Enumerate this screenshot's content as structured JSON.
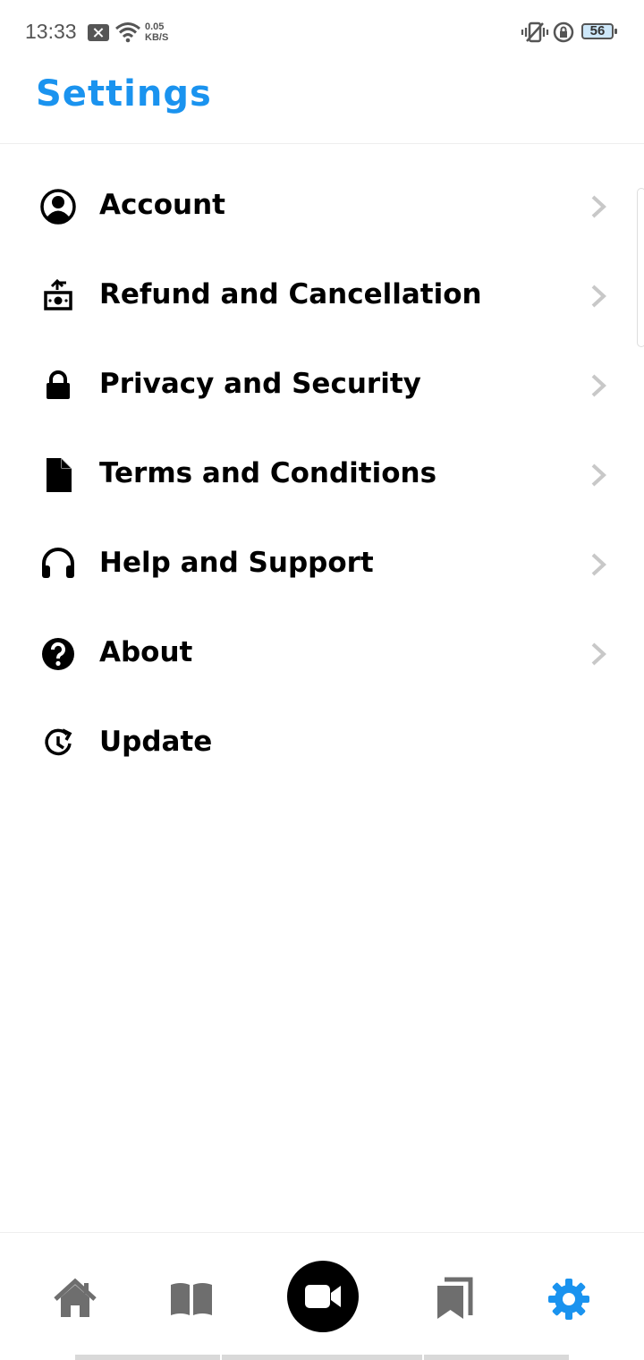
{
  "status_bar": {
    "time": "13:33",
    "speed_value": "0.05",
    "speed_unit": "KB/S",
    "battery": "56"
  },
  "header": {
    "title": "Settings"
  },
  "settings": [
    {
      "label": "Account",
      "icon": "account-circle-icon",
      "has_chevron": true
    },
    {
      "label": "Refund and Cancellation",
      "icon": "refund-icon",
      "has_chevron": true
    },
    {
      "label": "Privacy and Security",
      "icon": "lock-icon",
      "has_chevron": true
    },
    {
      "label": "Terms and Conditions",
      "icon": "document-icon",
      "has_chevron": true
    },
    {
      "label": "Help and Support",
      "icon": "headphones-icon",
      "has_chevron": true
    },
    {
      "label": "About",
      "icon": "help-circle-icon",
      "has_chevron": true
    },
    {
      "label": "Update",
      "icon": "update-icon",
      "has_chevron": false
    }
  ],
  "bottom_nav": [
    {
      "name": "home",
      "icon": "home-icon",
      "active": false
    },
    {
      "name": "library",
      "icon": "book-icon",
      "active": false
    },
    {
      "name": "record",
      "icon": "video-camera-icon",
      "active": false
    },
    {
      "name": "bookmarks",
      "icon": "bookmarks-icon",
      "active": false
    },
    {
      "name": "settings",
      "icon": "gear-icon",
      "active": true
    }
  ],
  "colors": {
    "accent": "#1a93ef",
    "inactive_icon": "#6e6e6e",
    "chevron": "#c8c8c8"
  }
}
